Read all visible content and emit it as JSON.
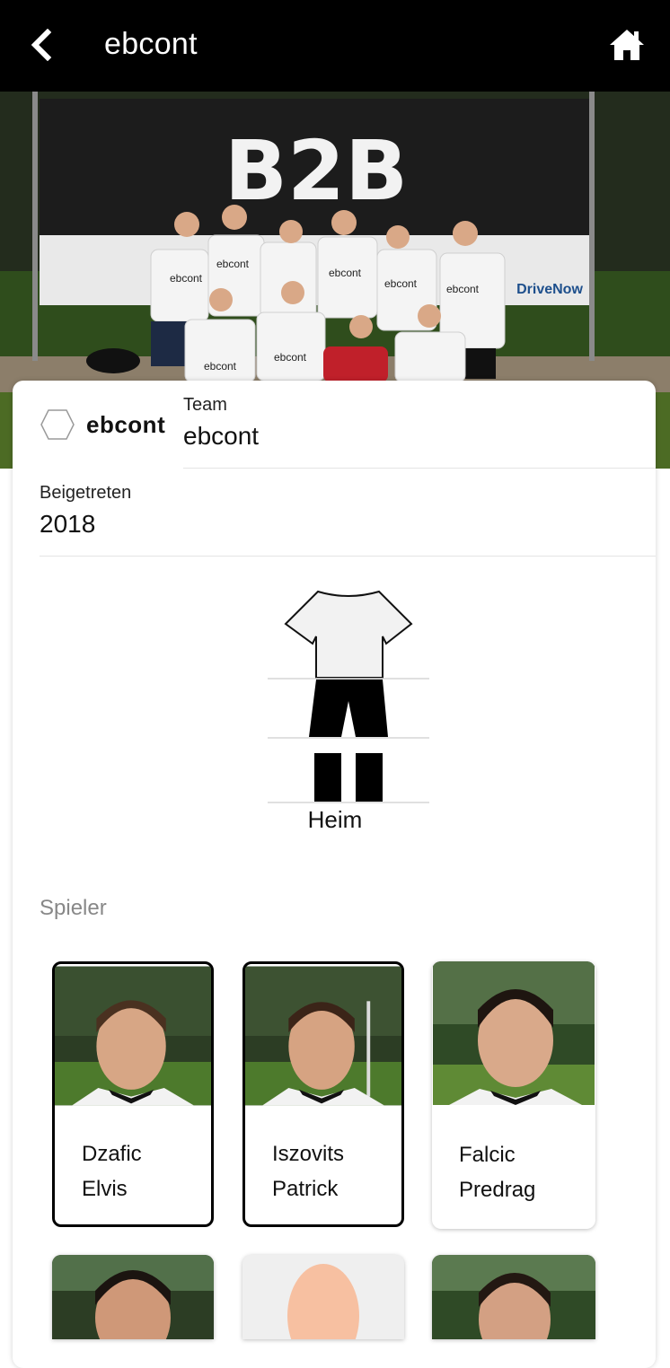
{
  "header": {
    "title": "ebcont",
    "back_icon": "chevron-left-icon",
    "home_icon": "home-icon"
  },
  "hero": {
    "banner_text": "B2B",
    "jersey_text": "ebcont",
    "sponsor_text": "DriveNow"
  },
  "team": {
    "logo_name": "ebcont",
    "team_label": "Team",
    "team_value": "ebcont",
    "joined_label": "Beigetreten",
    "joined_value": "2018"
  },
  "kit": {
    "label": "Heim",
    "shirt_color": "#f2f2f2",
    "shorts_color": "#000000",
    "socks_color": "#000000"
  },
  "players_section": {
    "title": "Spieler",
    "players": [
      {
        "last": "Dzafic",
        "first": "Elvis"
      },
      {
        "last": "Iszovits",
        "first": "Patrick"
      },
      {
        "last": "Falcic",
        "first": "Predrag"
      }
    ]
  }
}
